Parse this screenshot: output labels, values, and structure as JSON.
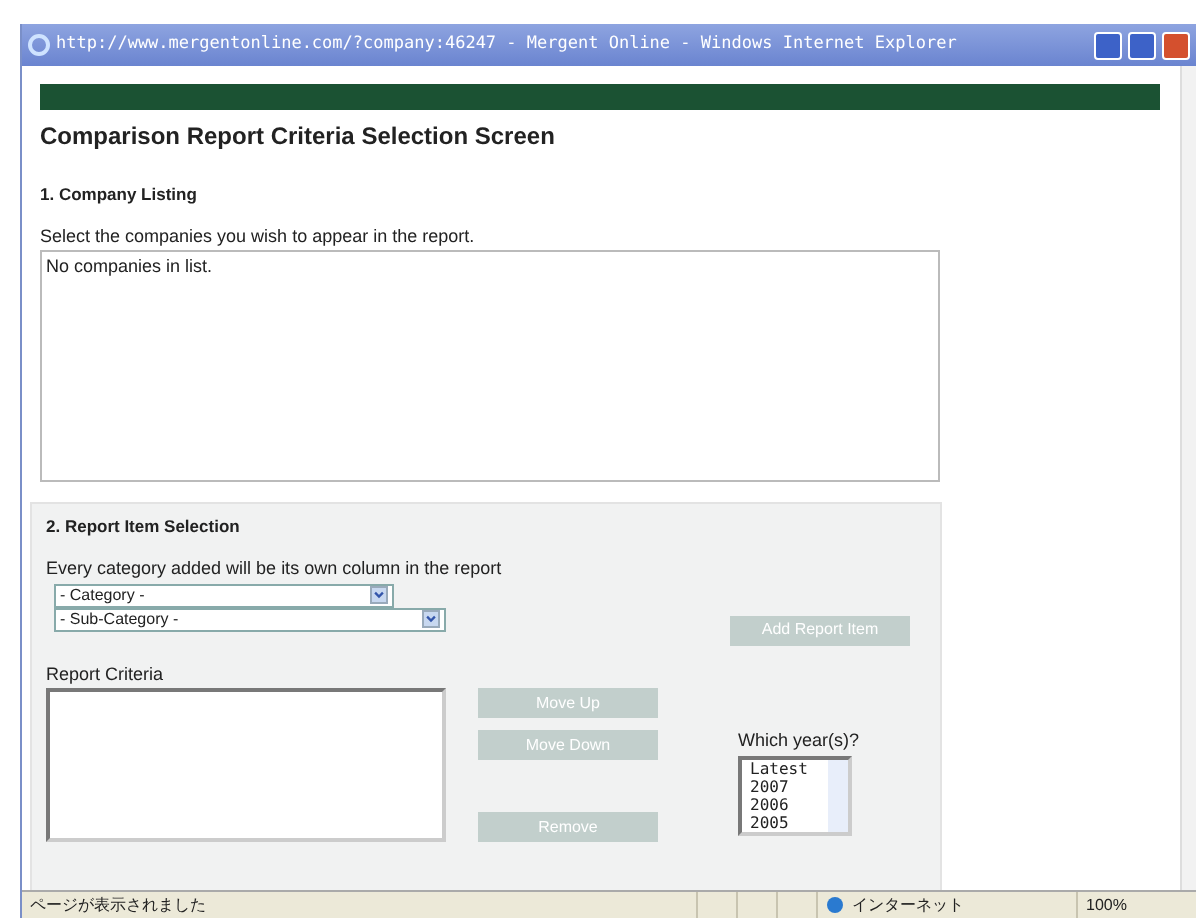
{
  "window": {
    "title": "http://www.mergentonline.com/?company:46247 - Mergent Online - Windows Internet Explorer"
  },
  "page": {
    "heading": "Comparison Report Criteria Selection Screen"
  },
  "company_listing": {
    "title": "1. Company Listing",
    "instruction": "Select the companies you wish to appear in the report.",
    "empty_text": "No companies in list."
  },
  "report_item_selection": {
    "title": "2. Report Item Selection",
    "instruction": "Every category added will be its own column in the report",
    "category": "- Category -",
    "sub_category": "- Sub-Category -",
    "add_button": "Add Report Item",
    "criteria_label": "Report Criteria",
    "buttons": [
      {
        "label": "Move Up"
      },
      {
        "label": "Move Down"
      },
      {
        "label": "Remove"
      }
    ],
    "years_label": "Which year(s)?",
    "years": [
      {
        "label": "Latest",
        "selected": false
      },
      {
        "label": "2007",
        "selected": false
      },
      {
        "label": "2006",
        "selected": false
      },
      {
        "label": "2005",
        "selected": false
      }
    ]
  },
  "status_bar": {
    "message": "ページが表示されました",
    "zone": "インターネット",
    "zoom": "100%"
  }
}
